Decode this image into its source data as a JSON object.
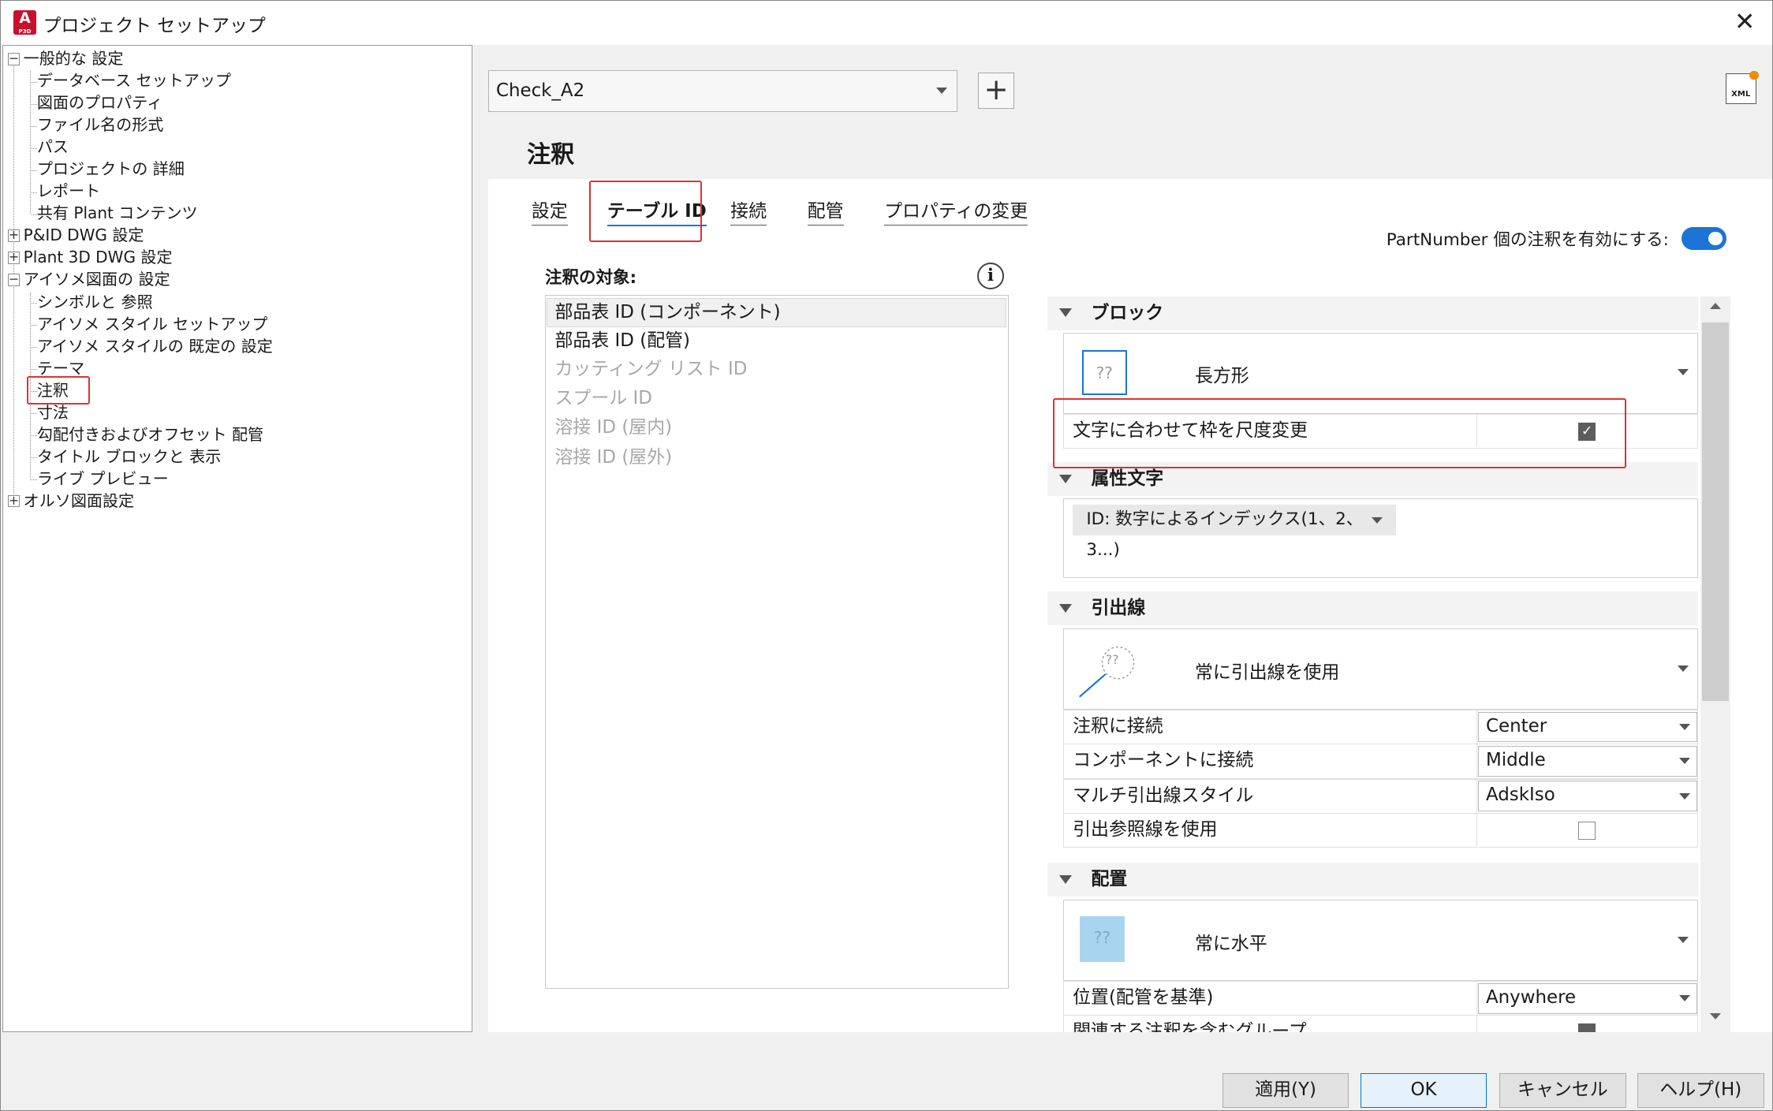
{
  "window": {
    "title": "プロジェクト セットアップ",
    "app_icon_letter": "A",
    "app_icon_sub": "P3D",
    "close_glyph": "✕"
  },
  "tree": {
    "items": [
      {
        "label": "一般的な 設定",
        "exp": "−"
      },
      {
        "label": "データベース セットアップ"
      },
      {
        "label": "図面のプロパティ"
      },
      {
        "label": "ファイル名の形式"
      },
      {
        "label": "パス"
      },
      {
        "label": "プロジェクトの 詳細"
      },
      {
        "label": "レポート"
      },
      {
        "label": "共有 Plant コンテンツ"
      },
      {
        "label": "P&ID DWG 設定",
        "exp": "+"
      },
      {
        "label": "Plant 3D DWG 設定",
        "exp": "+"
      },
      {
        "label": "アイソメ図面の 設定",
        "exp": "−"
      },
      {
        "label": "シンボルと 参照"
      },
      {
        "label": "アイソメ スタイル セットアップ"
      },
      {
        "label": "アイソメ スタイルの 既定の 設定"
      },
      {
        "label": "テーマ"
      },
      {
        "label": "注釈"
      },
      {
        "label": "寸法"
      },
      {
        "label": "勾配付きおよびオフセット 配管"
      },
      {
        "label": "タイトル ブロックと 表示"
      },
      {
        "label": "ライブ プレビュー"
      },
      {
        "label": "オルソ図面設定",
        "exp": "+"
      }
    ]
  },
  "toolbar": {
    "style_value": "Check_A2",
    "add_glyph": "+",
    "xml_label": "XML"
  },
  "page_title": "注釈",
  "tabs": [
    {
      "label": "設定"
    },
    {
      "label": "テーブル ID"
    },
    {
      "label": "接続"
    },
    {
      "label": "配管"
    },
    {
      "label": "プロパティの変更"
    }
  ],
  "partnumber_label": "PartNumber 個の注釈を有効にする:",
  "partnumber_enabled": true,
  "targets": {
    "label": "注釈の対象:",
    "info_glyph": "i",
    "items": [
      {
        "label": "部品表 ID (コンポーネント)",
        "enabled": true,
        "selected": true
      },
      {
        "label": "部品表 ID (配管)",
        "enabled": true
      },
      {
        "label": "カッティング リスト ID",
        "enabled": false
      },
      {
        "label": "スプール ID",
        "enabled": false
      },
      {
        "label": "溶接 ID (屋内)",
        "enabled": false
      },
      {
        "label": "溶接 ID (屋外)",
        "enabled": false
      }
    ]
  },
  "block": {
    "title": "ブロック",
    "shape_icon": "??",
    "shape_value": "長方形",
    "scale_label": "文字に合わせて枠を尺度変更",
    "scale_checked": true,
    "check_glyph": "✓"
  },
  "attr": {
    "title": "属性文字",
    "value": "ID: 数字によるインデックス(1、2、3...)"
  },
  "leader": {
    "title": "引出線",
    "icon": "??",
    "value": "常に引出線を使用",
    "rows": [
      {
        "key": "注釈に接続",
        "value": "Center"
      },
      {
        "key": "コンポーネントに接続",
        "value": "Middle"
      },
      {
        "key": "マルチ引出線スタイル",
        "value": "AdskIso"
      }
    ],
    "ref_label": "引出参照線を使用",
    "ref_checked": false
  },
  "placement": {
    "title": "配置",
    "icon": "??",
    "value": "常に水平",
    "pos_label": "位置(配管を基準)",
    "pos_value": "Anywhere",
    "cut_label": "関連する注釈を含むグループ"
  },
  "buttons": {
    "apply": "適用(Y)",
    "ok": "OK",
    "cancel": "キャンセル",
    "help": "ヘルプ(H)"
  },
  "colors": {
    "accent": "#1c74d6",
    "highlight": "#e03131",
    "app_icon": "#c8102e"
  }
}
